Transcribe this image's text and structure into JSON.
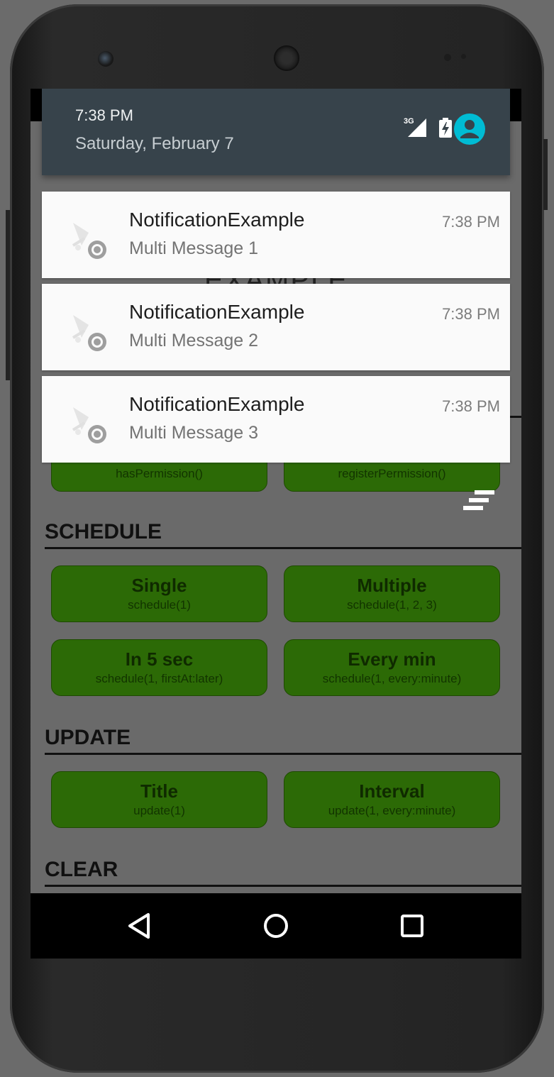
{
  "status": {
    "time": "7:38 PM",
    "date": "Saturday, February 7",
    "network_label": "3G",
    "icons": [
      "signal-3g-icon",
      "battery-charging-icon",
      "account-icon"
    ],
    "accent_color": "#00bcd4"
  },
  "notifications": [
    {
      "title": "NotificationExample",
      "text": "Multi Message 1",
      "time": "7:38 PM",
      "icon": "notification-bell-icon"
    },
    {
      "title": "NotificationExample",
      "text": "Multi Message 2",
      "time": "7:38 PM",
      "icon": "notification-bell-icon"
    },
    {
      "title": "NotificationExample",
      "text": "Multi Message 3",
      "time": "7:38 PM",
      "icon": "notification-bell-icon"
    }
  ],
  "app": {
    "partially_hidden_title": "EXAMPLE",
    "permission_buttons": [
      {
        "sub": "hasPermission()"
      },
      {
        "sub": "registerPermission()"
      }
    ],
    "sections": {
      "schedule": {
        "title": "SCHEDULE",
        "buttons": [
          {
            "label": "Single",
            "sub": "schedule(1)"
          },
          {
            "label": "Multiple",
            "sub": "schedule(1, 2, 3)"
          },
          {
            "label": "In 5 sec",
            "sub": "schedule(1, firstAt:later)"
          },
          {
            "label": "Every min",
            "sub": "schedule(1, every:minute)"
          }
        ]
      },
      "update": {
        "title": "UPDATE",
        "buttons": [
          {
            "label": "Title",
            "sub": "update(1)"
          },
          {
            "label": "Interval",
            "sub": "update(1, every:minute)"
          }
        ]
      },
      "clear": {
        "title": "CLEAR"
      }
    },
    "button_color": "#2c6a06"
  },
  "navigation": {
    "icons": [
      "back-icon",
      "home-icon",
      "recents-icon"
    ]
  }
}
